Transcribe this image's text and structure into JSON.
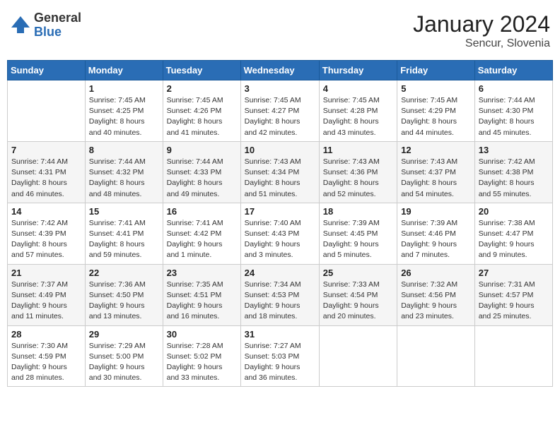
{
  "header": {
    "logo_general": "General",
    "logo_blue": "Blue",
    "month_year": "January 2024",
    "location": "Sencur, Slovenia"
  },
  "days_of_week": [
    "Sunday",
    "Monday",
    "Tuesday",
    "Wednesday",
    "Thursday",
    "Friday",
    "Saturday"
  ],
  "weeks": [
    [
      {
        "day": "",
        "info": ""
      },
      {
        "day": "1",
        "info": "Sunrise: 7:45 AM\nSunset: 4:25 PM\nDaylight: 8 hours\nand 40 minutes."
      },
      {
        "day": "2",
        "info": "Sunrise: 7:45 AM\nSunset: 4:26 PM\nDaylight: 8 hours\nand 41 minutes."
      },
      {
        "day": "3",
        "info": "Sunrise: 7:45 AM\nSunset: 4:27 PM\nDaylight: 8 hours\nand 42 minutes."
      },
      {
        "day": "4",
        "info": "Sunrise: 7:45 AM\nSunset: 4:28 PM\nDaylight: 8 hours\nand 43 minutes."
      },
      {
        "day": "5",
        "info": "Sunrise: 7:45 AM\nSunset: 4:29 PM\nDaylight: 8 hours\nand 44 minutes."
      },
      {
        "day": "6",
        "info": "Sunrise: 7:44 AM\nSunset: 4:30 PM\nDaylight: 8 hours\nand 45 minutes."
      }
    ],
    [
      {
        "day": "7",
        "info": "Sunrise: 7:44 AM\nSunset: 4:31 PM\nDaylight: 8 hours\nand 46 minutes."
      },
      {
        "day": "8",
        "info": "Sunrise: 7:44 AM\nSunset: 4:32 PM\nDaylight: 8 hours\nand 48 minutes."
      },
      {
        "day": "9",
        "info": "Sunrise: 7:44 AM\nSunset: 4:33 PM\nDaylight: 8 hours\nand 49 minutes."
      },
      {
        "day": "10",
        "info": "Sunrise: 7:43 AM\nSunset: 4:34 PM\nDaylight: 8 hours\nand 51 minutes."
      },
      {
        "day": "11",
        "info": "Sunrise: 7:43 AM\nSunset: 4:36 PM\nDaylight: 8 hours\nand 52 minutes."
      },
      {
        "day": "12",
        "info": "Sunrise: 7:43 AM\nSunset: 4:37 PM\nDaylight: 8 hours\nand 54 minutes."
      },
      {
        "day": "13",
        "info": "Sunrise: 7:42 AM\nSunset: 4:38 PM\nDaylight: 8 hours\nand 55 minutes."
      }
    ],
    [
      {
        "day": "14",
        "info": "Sunrise: 7:42 AM\nSunset: 4:39 PM\nDaylight: 8 hours\nand 57 minutes."
      },
      {
        "day": "15",
        "info": "Sunrise: 7:41 AM\nSunset: 4:41 PM\nDaylight: 8 hours\nand 59 minutes."
      },
      {
        "day": "16",
        "info": "Sunrise: 7:41 AM\nSunset: 4:42 PM\nDaylight: 9 hours\nand 1 minute."
      },
      {
        "day": "17",
        "info": "Sunrise: 7:40 AM\nSunset: 4:43 PM\nDaylight: 9 hours\nand 3 minutes."
      },
      {
        "day": "18",
        "info": "Sunrise: 7:39 AM\nSunset: 4:45 PM\nDaylight: 9 hours\nand 5 minutes."
      },
      {
        "day": "19",
        "info": "Sunrise: 7:39 AM\nSunset: 4:46 PM\nDaylight: 9 hours\nand 7 minutes."
      },
      {
        "day": "20",
        "info": "Sunrise: 7:38 AM\nSunset: 4:47 PM\nDaylight: 9 hours\nand 9 minutes."
      }
    ],
    [
      {
        "day": "21",
        "info": "Sunrise: 7:37 AM\nSunset: 4:49 PM\nDaylight: 9 hours\nand 11 minutes."
      },
      {
        "day": "22",
        "info": "Sunrise: 7:36 AM\nSunset: 4:50 PM\nDaylight: 9 hours\nand 13 minutes."
      },
      {
        "day": "23",
        "info": "Sunrise: 7:35 AM\nSunset: 4:51 PM\nDaylight: 9 hours\nand 16 minutes."
      },
      {
        "day": "24",
        "info": "Sunrise: 7:34 AM\nSunset: 4:53 PM\nDaylight: 9 hours\nand 18 minutes."
      },
      {
        "day": "25",
        "info": "Sunrise: 7:33 AM\nSunset: 4:54 PM\nDaylight: 9 hours\nand 20 minutes."
      },
      {
        "day": "26",
        "info": "Sunrise: 7:32 AM\nSunset: 4:56 PM\nDaylight: 9 hours\nand 23 minutes."
      },
      {
        "day": "27",
        "info": "Sunrise: 7:31 AM\nSunset: 4:57 PM\nDaylight: 9 hours\nand 25 minutes."
      }
    ],
    [
      {
        "day": "28",
        "info": "Sunrise: 7:30 AM\nSunset: 4:59 PM\nDaylight: 9 hours\nand 28 minutes."
      },
      {
        "day": "29",
        "info": "Sunrise: 7:29 AM\nSunset: 5:00 PM\nDaylight: 9 hours\nand 30 minutes."
      },
      {
        "day": "30",
        "info": "Sunrise: 7:28 AM\nSunset: 5:02 PM\nDaylight: 9 hours\nand 33 minutes."
      },
      {
        "day": "31",
        "info": "Sunrise: 7:27 AM\nSunset: 5:03 PM\nDaylight: 9 hours\nand 36 minutes."
      },
      {
        "day": "",
        "info": ""
      },
      {
        "day": "",
        "info": ""
      },
      {
        "day": "",
        "info": ""
      }
    ]
  ]
}
